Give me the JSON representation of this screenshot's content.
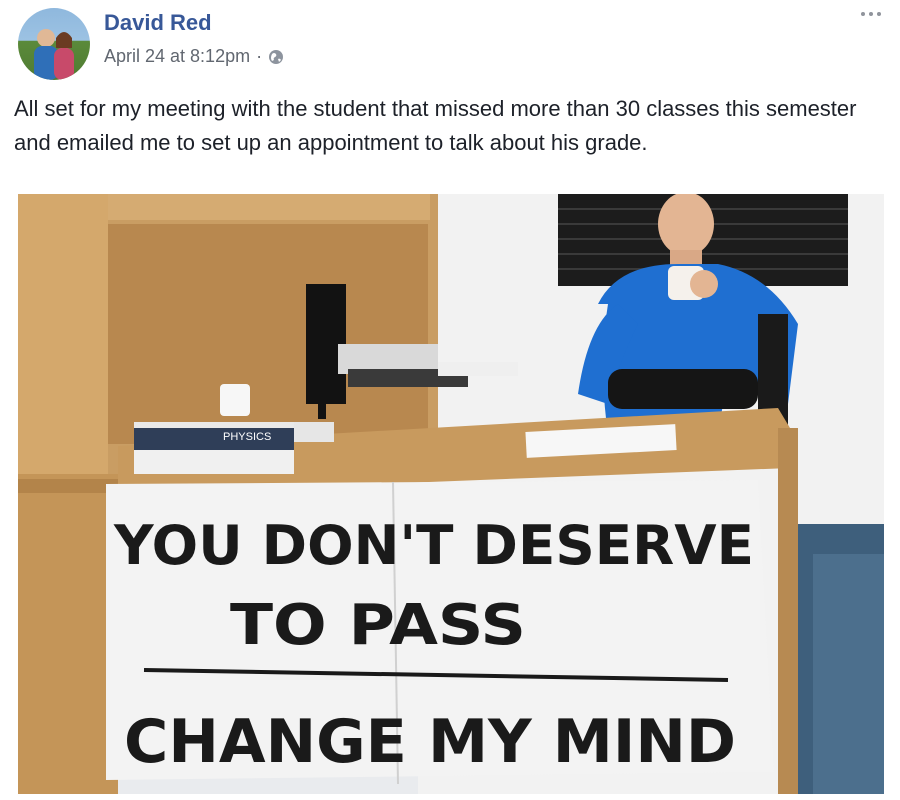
{
  "post": {
    "author": "David Red",
    "timestamp": "April 24 at 8:12pm",
    "separator": "·",
    "privacy_icon": "globe-icon",
    "more_icon": "more-options-icon",
    "text": "All set for my meeting with the student that missed more than 30 classes this semester and emailed me to set up an appointment to talk about his grade."
  },
  "photo": {
    "sign_line_1": "YOU DON'T DESERVE",
    "sign_line_2": "TO PASS",
    "sign_line_3": "CHANGE MY MIND",
    "book_label": "PHYSICS"
  },
  "colors": {
    "author_link": "#385898",
    "meta_text": "#616770",
    "body_text": "#1d2129",
    "shirt_blue": "#1f6fd1",
    "desk_wood": "#c89a5e"
  }
}
